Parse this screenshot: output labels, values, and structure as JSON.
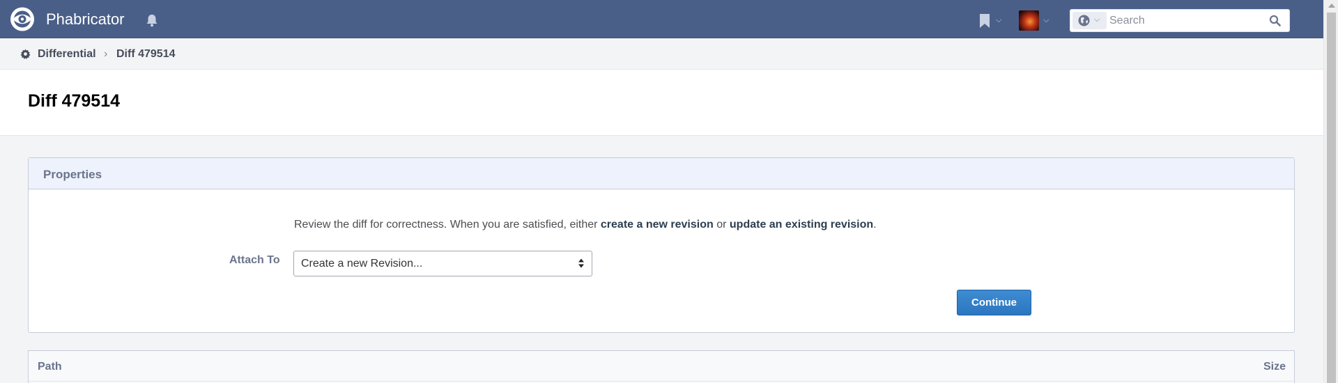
{
  "app": {
    "name": "Phabricator"
  },
  "search": {
    "placeholder": "Search"
  },
  "breadcrumb": {
    "items": [
      "Differential",
      "Diff 479514"
    ],
    "separator": "›"
  },
  "page": {
    "title": "Diff 479514"
  },
  "properties": {
    "title": "Properties",
    "instruction_prefix": "Review the diff for correctness. When you are satisfied, either ",
    "instruction_link1": "create a new revision",
    "instruction_mid": " or ",
    "instruction_link2": "update an existing revision",
    "instruction_suffix": ".",
    "attach_label": "Attach To",
    "attach_value": "Create a new Revision...",
    "continue_label": "Continue"
  },
  "table": {
    "columns": [
      "Path",
      "Size"
    ]
  },
  "icons": {
    "logo": "phabricator-eye-logo",
    "bell": "bell-icon",
    "bookmark": "bookmark-icon",
    "globe": "globe-icon",
    "search": "search-icon",
    "gear": "gear-icon"
  },
  "colors": {
    "topbar": "#4a5f88",
    "button": "#3e8cd2",
    "box_header": "#edf2fc"
  }
}
